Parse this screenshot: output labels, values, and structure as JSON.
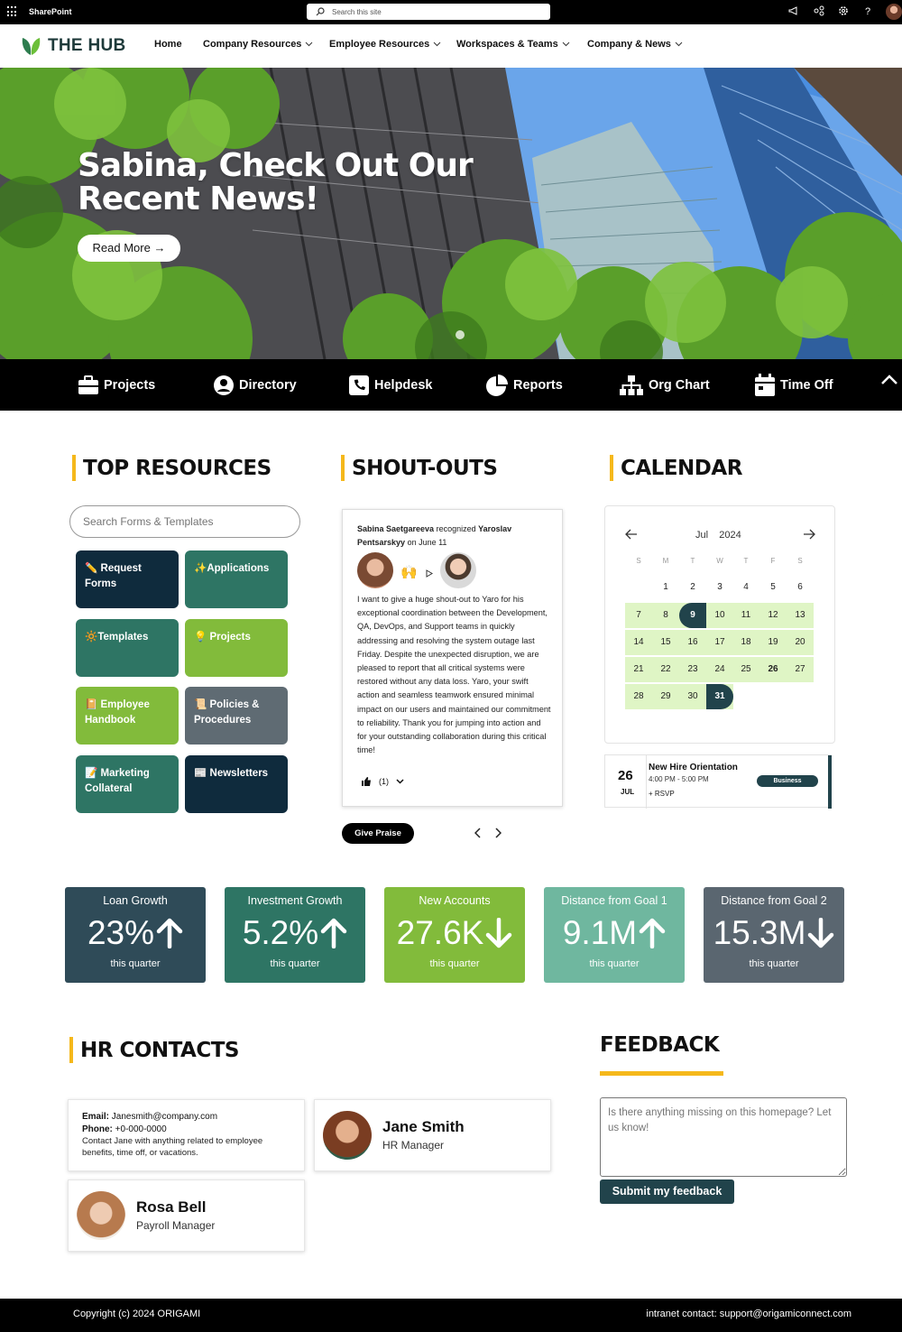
{
  "suitebar": {
    "app_name": "SharePoint",
    "search_placeholder": "Search this site"
  },
  "nav": {
    "logo": "THE HUB",
    "items": [
      "Home",
      "Company Resources",
      "Employee Resources",
      "Workspaces & Teams",
      "Company & News"
    ]
  },
  "hero": {
    "title": "Sabina, Check Out Our Recent News!",
    "button": "Read More →"
  },
  "quick_links": [
    "Projects",
    "Directory",
    "Helpdesk",
    "Reports",
    "Org Chart",
    "Time Off"
  ],
  "top_resources": {
    "title": "TOP RESOURCES",
    "search_placeholder": "Search Forms & Templates",
    "tiles": [
      {
        "label": "✏️ Request Forms",
        "color": "#0f2b3d"
      },
      {
        "label": "✨Applications",
        "color": "#2e7564"
      },
      {
        "label": "🔆Templates",
        "color": "#2e7564"
      },
      {
        "label": "💡 Projects",
        "color": "#82bb3b"
      },
      {
        "label": "📔 Employee Handbook",
        "color": "#82bb3b"
      },
      {
        "label": "📜 Policies & Procedures",
        "color": "#5f6b73"
      },
      {
        "label": "📝 Marketing Collateral",
        "color": "#2e7564"
      },
      {
        "label": "📰 Newsletters",
        "color": "#0f2b3d"
      }
    ]
  },
  "shoutouts": {
    "title": "SHOUT-OUTS",
    "from": "Sabina Saetgareeva",
    "verb": "recognized",
    "to": "Yaroslav Pentsarskyy",
    "date": "on June 11",
    "message": "I want to give a huge shout-out to Yaro for his exceptional coordination between the Development, QA, DevOps, and Support teams in quickly addressing and resolving the system outage last Friday. Despite the unexpected disruption, we are pleased to report that all critical systems were restored without any data loss. Yaro, your swift action and seamless teamwork ensured minimal impact on our users and maintained our commitment to reliability. Thank you for jumping into action and for your outstanding collaboration during this critical time!",
    "like_count": "(1)",
    "give_praise": "Give Praise",
    "reaction_emoji": "🙌"
  },
  "calendar": {
    "title": "CALENDAR",
    "month": "Jul",
    "year": "2024",
    "weekdays": [
      "S",
      "M",
      "T",
      "W",
      "T",
      "F",
      "S"
    ],
    "weeks": [
      [
        "",
        "1",
        "2",
        "3",
        "4",
        "5",
        "6"
      ],
      [
        "7",
        "8",
        "9",
        "10",
        "11",
        "12",
        "13"
      ],
      [
        "14",
        "15",
        "16",
        "17",
        "18",
        "19",
        "20"
      ],
      [
        "21",
        "22",
        "23",
        "24",
        "25",
        "26",
        "27"
      ],
      [
        "28",
        "29",
        "30",
        "31",
        "",
        "",
        ""
      ]
    ],
    "selected_day": "9",
    "today": "26",
    "range_end": "31",
    "event": {
      "day": "26",
      "month": "JUL",
      "title": "New Hire Orientation",
      "time": "4:00 PM - 5:00 PM",
      "rsvp": "RSVP",
      "tag": "Business"
    }
  },
  "kpis": [
    {
      "label": "Loan Growth",
      "value": "23%",
      "direction": "up",
      "sub": "this quarter",
      "color": "#2f4b58"
    },
    {
      "label": "Investment Growth",
      "value": "5.2%",
      "direction": "up",
      "sub": "this quarter",
      "color": "#2e7564"
    },
    {
      "label": "New Accounts",
      "value": "27.6K",
      "direction": "down",
      "sub": "this quarter",
      "color": "#82bb3b"
    },
    {
      "label": "Distance from Goal 1",
      "value": "9.1M",
      "direction": "up",
      "sub": "this quarter",
      "color": "#6fb79f"
    },
    {
      "label": "Distance from Goal 2",
      "value": "15.3M",
      "direction": "down",
      "sub": "this quarter",
      "color": "#5a6670"
    }
  ],
  "hr": {
    "title": "HR CONTACTS",
    "info": {
      "email_label": "Email:",
      "email": "Janesmith@company.com",
      "phone_label": "Phone:",
      "phone": "+0-000-0000",
      "note": "Contact Jane with anything related to employee benefits, time off, or vacations."
    },
    "contacts": [
      {
        "name": "Jane Smith",
        "role": "HR Manager"
      },
      {
        "name": "Rosa Bell",
        "role": "Payroll Manager"
      }
    ]
  },
  "feedback": {
    "title": "FEEDBACK",
    "placeholder": "Is there anything missing on this homepage? Let us know!",
    "submit": "Submit my feedback"
  },
  "footer": {
    "copyright": "Copyright (c) 2024 ORIGAMI",
    "contact": "intranet contact: support@origamiconnect.com"
  }
}
